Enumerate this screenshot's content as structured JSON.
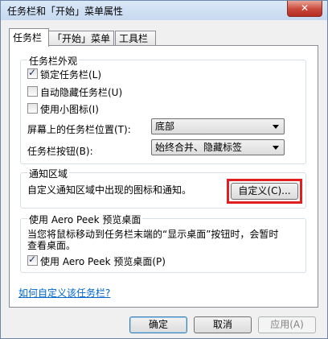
{
  "window": {
    "title": "任务栏和「开始」菜单属性",
    "close_symbol": "✕"
  },
  "tabs": [
    {
      "label": "任务栏",
      "active": true
    },
    {
      "label": "「开始」菜单",
      "active": false
    },
    {
      "label": "工具栏",
      "active": false
    }
  ],
  "appearance": {
    "title": "任务栏外观",
    "lock_taskbar": {
      "label": "锁定任务栏(L)",
      "checked": true
    },
    "auto_hide": {
      "label": "自动隐藏任务栏(U)",
      "checked": false
    },
    "small_icons": {
      "label": "使用小图标(I)",
      "checked": false
    },
    "location": {
      "label": "屏幕上的任务栏位置(T):",
      "value": "底部"
    },
    "buttons": {
      "label": "任务栏按钮(B):",
      "value": "始终合并、隐藏标签"
    }
  },
  "notification": {
    "title": "通知区域",
    "description": "自定义通知区域中出现的图标和通知。",
    "customize_button": "自定义(C)..."
  },
  "aero_peek": {
    "title": "使用 Aero Peek 预览桌面",
    "description_line1": "当您将鼠标移动到任务栏末端的“显示桌面”按钮时，会暂时",
    "description_line2": "查看桌面。",
    "checkbox": {
      "label": "使用 Aero Peek 预览桌面(P)",
      "checked": true
    }
  },
  "help_link": "如何自定义该任务栏?",
  "footer": {
    "ok": "确定",
    "cancel": "取消",
    "apply": "应用(A)"
  }
}
